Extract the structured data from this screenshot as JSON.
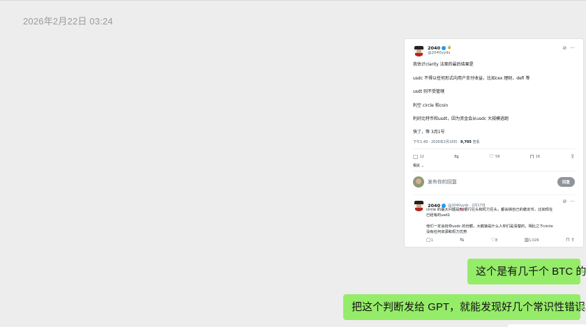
{
  "chat": {
    "timestamp": "2026年2月22日 03:24",
    "messages": [
      {
        "text": "这个是有几千个 BTC 的",
        "sender": "me"
      },
      {
        "text": "把这个判断发给 GPT，就能发现好几个常识性错误。",
        "sender": "me"
      }
    ],
    "bubble_color": "#95ec69"
  },
  "post": {
    "author": "2040",
    "handle": "@2040yyds",
    "lines": [
      "我估计clarity 法案的最后结果是",
      "usdc 不得以任何形式向用户支付收益，比如cex 理财，defi 等",
      "usdt 则不受管辖",
      "利空 circle 和coin",
      "利好比特币和usdt，因为资金会从usdc 大规模逃跑",
      "快了，等 3月1号"
    ],
    "meta_time": "下午1:49 · 2026年2月18日 · ",
    "views": "9,705",
    "views_label": " 查看",
    "replies": "12",
    "likes": "59",
    "bookmarks": "16",
    "related": "相关 ⌄",
    "reply_placeholder": "发布你的回复",
    "reply_button": "回复"
  },
  "reply": {
    "author": "2040",
    "handle_date": "@2040yyds · 2月17日",
    "lines": [
      "circle 的最大问题是🇺🇸银行巨头和权力巨头，都会搞自己的稳定币，比如现在",
      "已经有的usd1",
      "",
      "他们一定会抢夺usdc 的份额，大鹅狼是什么人你们是清楚的，相比之下circle",
      "没有任何资源和权力优势"
    ],
    "replies": "1",
    "likes": "8",
    "views": "1,026"
  },
  "icons": {
    "reply": "comment-icon",
    "repost": "repost-icon",
    "like": "heart-icon",
    "bookmark": "bookmark-icon",
    "share": "share-icon",
    "more": "more-icon",
    "grok": "grok-icon",
    "views": "views-icon"
  }
}
